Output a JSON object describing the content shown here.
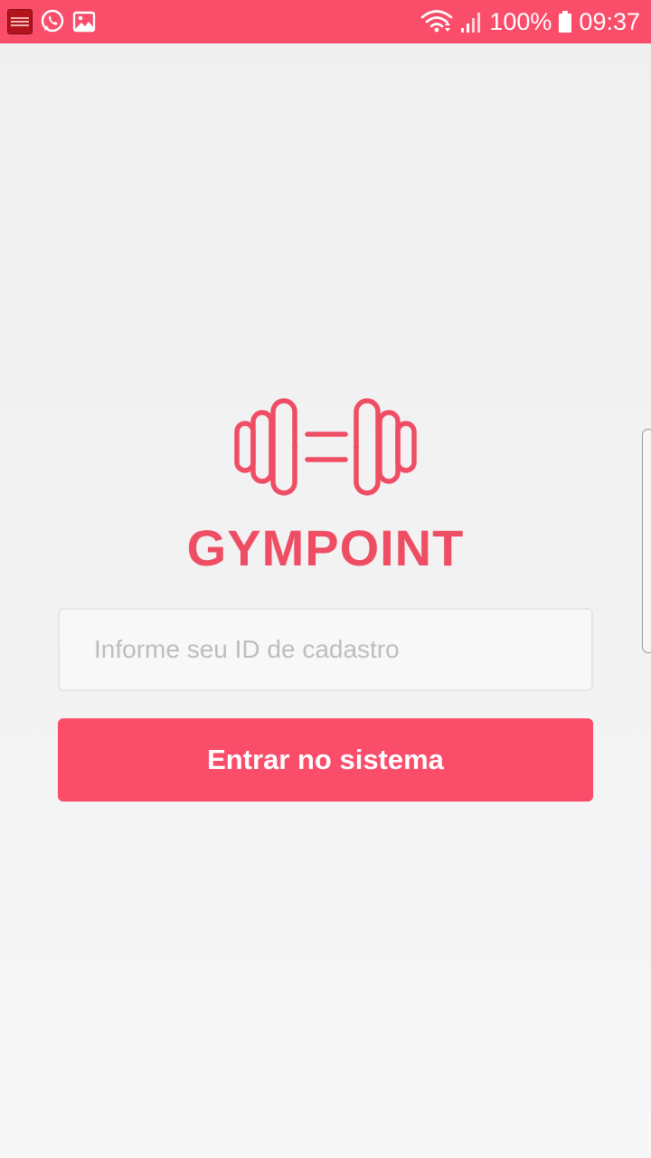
{
  "status_bar": {
    "background": "#f94d6a",
    "left_icons": [
      "news-app-icon",
      "whatsapp-icon",
      "gallery-icon"
    ],
    "right_icons": [
      "wifi-icon",
      "signal-icon",
      "battery-icon"
    ],
    "battery_percent": "100%",
    "time": "09:37"
  },
  "brand": {
    "logo_icon": "dumbbell-icon",
    "name": "GYMPOINT",
    "color": "#ee4d64"
  },
  "login": {
    "id_input": {
      "value": "",
      "placeholder": "Informe seu ID de cadastro"
    },
    "submit_label": "Entrar no sistema",
    "button_color": "#f94d6a"
  }
}
